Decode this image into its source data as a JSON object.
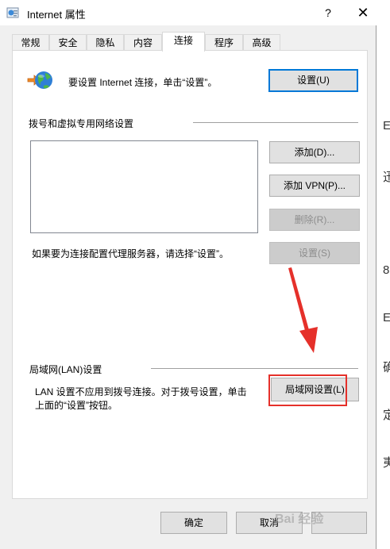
{
  "window": {
    "title": "Internet 属性",
    "help_glyph": "?",
    "close_glyph": "✕"
  },
  "tabs": [
    {
      "label": "常规"
    },
    {
      "label": "安全"
    },
    {
      "label": "隐私"
    },
    {
      "label": "内容"
    },
    {
      "label": "连接"
    },
    {
      "label": "程序"
    },
    {
      "label": "高级"
    }
  ],
  "connect": {
    "setup_text": "要设置 Internet 连接，单击“设置”。",
    "setup_button": "设置(U)"
  },
  "dialup": {
    "heading": "拨号和虚拟专用网络设置",
    "add_button": "添加(D)...",
    "add_vpn_button": "添加 VPN(P)...",
    "delete_button": "删除(R)...",
    "proxy_text": "如果要为连接配置代理服务器，请选择“设置”。",
    "settings_button": "设置(S)"
  },
  "lan": {
    "heading": "局域网(LAN)设置",
    "desc_line1": "LAN 设置不应用到拨号连接。对于拨号设置，单击",
    "desc_line2": "上面的“设置”按钮。",
    "button": "局域网设置(L)"
  },
  "footer": {
    "ok": "确定",
    "cancel": "取消"
  },
  "watermark": "Bai 经验",
  "colors": {
    "accent": "#0078d7",
    "highlight_box": "#e5302a",
    "arrow": "#e5302a"
  }
}
